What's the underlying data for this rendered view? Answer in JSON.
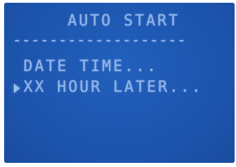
{
  "screen": {
    "title": "AUTO START",
    "divider": "-------------------",
    "menu": {
      "items": [
        {
          "label": "DATE TIME...",
          "selected": false
        },
        {
          "label": "XX HOUR LATER...",
          "selected": true
        }
      ]
    },
    "colors": {
      "background": "#1e56b0",
      "text": "#8fb1e8"
    },
    "cursor_icon": "triangle-right-icon"
  }
}
